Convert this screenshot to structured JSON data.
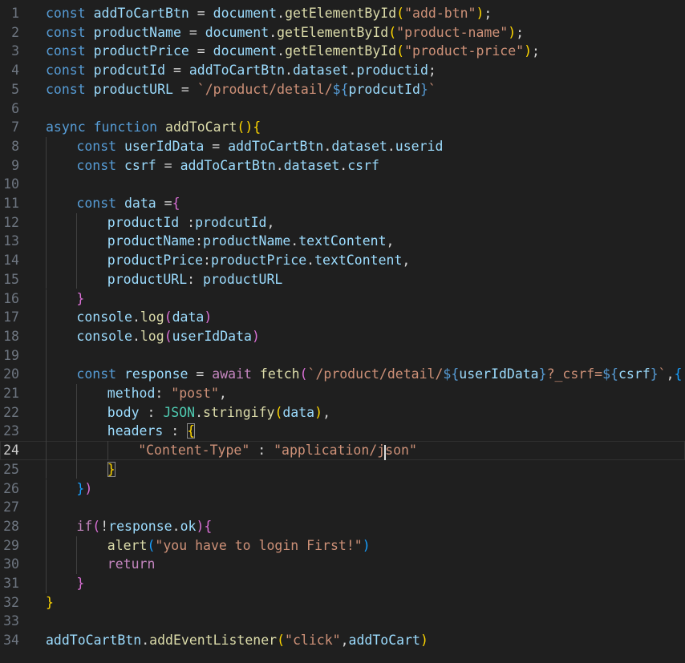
{
  "editor": {
    "current_line": 24,
    "colors": {
      "background": "#1f1f1f",
      "keyword": "#569cd6",
      "control": "#c586c0",
      "variable": "#9cdcfe",
      "function": "#dcdcaa",
      "string": "#ce9178",
      "object": "#4ec9b0",
      "bracket1": "#ffd700",
      "bracket2": "#da70d6",
      "bracket3": "#179fff",
      "text": "#d4d4d4"
    },
    "lines": [
      {
        "n": "1",
        "ind": 0,
        "tokens": [
          [
            "const ",
            "kw"
          ],
          [
            "addToCartBtn",
            "cst"
          ],
          [
            " = ",
            "tx"
          ],
          [
            "document",
            "var"
          ],
          [
            ".",
            "tx"
          ],
          [
            "getElementById",
            "fn"
          ],
          [
            "(",
            "b1"
          ],
          [
            "\"add-btn\"",
            "str"
          ],
          [
            ")",
            "b1"
          ],
          [
            ";",
            "tx"
          ]
        ]
      },
      {
        "n": "2",
        "ind": 0,
        "tokens": [
          [
            "const ",
            "kw"
          ],
          [
            "productName",
            "cst"
          ],
          [
            " = ",
            "tx"
          ],
          [
            "document",
            "var"
          ],
          [
            ".",
            "tx"
          ],
          [
            "getElementById",
            "fn"
          ],
          [
            "(",
            "b1"
          ],
          [
            "\"product-name\"",
            "str"
          ],
          [
            ")",
            "b1"
          ],
          [
            ";",
            "tx"
          ]
        ]
      },
      {
        "n": "3",
        "ind": 0,
        "tokens": [
          [
            "const ",
            "kw"
          ],
          [
            "productPrice",
            "cst"
          ],
          [
            " = ",
            "tx"
          ],
          [
            "document",
            "var"
          ],
          [
            ".",
            "tx"
          ],
          [
            "getElementById",
            "fn"
          ],
          [
            "(",
            "b1"
          ],
          [
            "\"product-price\"",
            "str"
          ],
          [
            ")",
            "b1"
          ],
          [
            ";",
            "tx"
          ]
        ]
      },
      {
        "n": "4",
        "ind": 0,
        "tokens": [
          [
            "const ",
            "kw"
          ],
          [
            "prodcutId",
            "cst"
          ],
          [
            " = ",
            "tx"
          ],
          [
            "addToCartBtn",
            "cst"
          ],
          [
            ".",
            "tx"
          ],
          [
            "dataset",
            "var"
          ],
          [
            ".",
            "tx"
          ],
          [
            "productid",
            "var"
          ],
          [
            ";",
            "tx"
          ]
        ]
      },
      {
        "n": "5",
        "ind": 0,
        "tokens": [
          [
            "const ",
            "kw"
          ],
          [
            "productURL",
            "cst"
          ],
          [
            " = ",
            "tx"
          ],
          [
            "`/product/detail/",
            "str"
          ],
          [
            "${",
            "kw"
          ],
          [
            "prodcutId",
            "cst"
          ],
          [
            "}",
            "kw"
          ],
          [
            "`",
            "str"
          ]
        ]
      },
      {
        "n": "6",
        "ind": 0,
        "tokens": []
      },
      {
        "n": "7",
        "ind": 0,
        "tokens": [
          [
            "async ",
            "kw"
          ],
          [
            "function ",
            "kw"
          ],
          [
            "addToCart",
            "fn"
          ],
          [
            "()",
            "b1"
          ],
          [
            "{",
            "b1"
          ]
        ]
      },
      {
        "n": "8",
        "ind": 1,
        "tokens": [
          [
            "const ",
            "kw"
          ],
          [
            "userIdData",
            "cst"
          ],
          [
            " = ",
            "tx"
          ],
          [
            "addToCartBtn",
            "cst"
          ],
          [
            ".",
            "tx"
          ],
          [
            "dataset",
            "var"
          ],
          [
            ".",
            "tx"
          ],
          [
            "userid",
            "var"
          ]
        ]
      },
      {
        "n": "9",
        "ind": 1,
        "tokens": [
          [
            "const ",
            "kw"
          ],
          [
            "csrf",
            "cst"
          ],
          [
            " = ",
            "tx"
          ],
          [
            "addToCartBtn",
            "cst"
          ],
          [
            ".",
            "tx"
          ],
          [
            "dataset",
            "var"
          ],
          [
            ".",
            "tx"
          ],
          [
            "csrf",
            "var"
          ]
        ]
      },
      {
        "n": "10",
        "ind": 1,
        "tokens": []
      },
      {
        "n": "11",
        "ind": 1,
        "tokens": [
          [
            "const ",
            "kw"
          ],
          [
            "data",
            "cst"
          ],
          [
            " =",
            "tx"
          ],
          [
            "{",
            "b2"
          ]
        ]
      },
      {
        "n": "12",
        "ind": 2,
        "tokens": [
          [
            "productId ",
            "var"
          ],
          [
            ":",
            "tx"
          ],
          [
            "prodcutId",
            "cst"
          ],
          [
            ",",
            "tx"
          ]
        ]
      },
      {
        "n": "13",
        "ind": 2,
        "tokens": [
          [
            "productName",
            "var"
          ],
          [
            ":",
            "tx"
          ],
          [
            "productName",
            "cst"
          ],
          [
            ".",
            "tx"
          ],
          [
            "textContent",
            "var"
          ],
          [
            ",",
            "tx"
          ]
        ]
      },
      {
        "n": "14",
        "ind": 2,
        "tokens": [
          [
            "productPrice",
            "var"
          ],
          [
            ":",
            "tx"
          ],
          [
            "productPrice",
            "cst"
          ],
          [
            ".",
            "tx"
          ],
          [
            "textContent",
            "var"
          ],
          [
            ",",
            "tx"
          ]
        ]
      },
      {
        "n": "15",
        "ind": 2,
        "tokens": [
          [
            "productURL",
            "var"
          ],
          [
            ": ",
            "tx"
          ],
          [
            "productURL",
            "cst"
          ]
        ]
      },
      {
        "n": "16",
        "ind": 1,
        "tokens": [
          [
            "}",
            "b2"
          ]
        ]
      },
      {
        "n": "17",
        "ind": 1,
        "tokens": [
          [
            "console",
            "var"
          ],
          [
            ".",
            "tx"
          ],
          [
            "log",
            "fn"
          ],
          [
            "(",
            "b2"
          ],
          [
            "data",
            "cst"
          ],
          [
            ")",
            "b2"
          ]
        ]
      },
      {
        "n": "18",
        "ind": 1,
        "tokens": [
          [
            "console",
            "var"
          ],
          [
            ".",
            "tx"
          ],
          [
            "log",
            "fn"
          ],
          [
            "(",
            "b2"
          ],
          [
            "userIdData",
            "cst"
          ],
          [
            ")",
            "b2"
          ]
        ]
      },
      {
        "n": "19",
        "ind": 1,
        "tokens": []
      },
      {
        "n": "20",
        "ind": 1,
        "tokens": [
          [
            "const ",
            "kw"
          ],
          [
            "response",
            "cst"
          ],
          [
            " = ",
            "tx"
          ],
          [
            "await ",
            "ctl"
          ],
          [
            "fetch",
            "fn"
          ],
          [
            "(",
            "b2"
          ],
          [
            "`/product/detail/",
            "str"
          ],
          [
            "${",
            "kw"
          ],
          [
            "userIdData",
            "cst"
          ],
          [
            "}",
            "kw"
          ],
          [
            "?_csrf=",
            "str"
          ],
          [
            "${",
            "kw"
          ],
          [
            "csrf",
            "cst"
          ],
          [
            "}",
            "kw"
          ],
          [
            "`",
            "str"
          ],
          [
            ",",
            "tx"
          ],
          [
            "{",
            "b3"
          ]
        ]
      },
      {
        "n": "21",
        "ind": 2,
        "tokens": [
          [
            "method",
            "var"
          ],
          [
            ": ",
            "tx"
          ],
          [
            "\"post\"",
            "str"
          ],
          [
            ",",
            "tx"
          ]
        ]
      },
      {
        "n": "22",
        "ind": 2,
        "tokens": [
          [
            "body ",
            "var"
          ],
          [
            ": ",
            "tx"
          ],
          [
            "JSON",
            "obj"
          ],
          [
            ".",
            "tx"
          ],
          [
            "stringify",
            "fn"
          ],
          [
            "(",
            "b1"
          ],
          [
            "data",
            "cst"
          ],
          [
            ")",
            "b1"
          ],
          [
            ",",
            "tx"
          ]
        ]
      },
      {
        "n": "23",
        "ind": 2,
        "tokens": [
          [
            "headers ",
            "var"
          ],
          [
            ": ",
            "tx"
          ],
          [
            "{",
            "b1m"
          ]
        ]
      },
      {
        "n": "24",
        "ind": 3,
        "tokens": [
          [
            "\"Content-Type\"",
            "str"
          ],
          [
            " : ",
            "tx"
          ],
          [
            "\"application/j",
            "str"
          ],
          [
            "son\"",
            "str"
          ]
        ]
      },
      {
        "n": "25",
        "ind": 2,
        "tokens": [
          [
            "}",
            "b1m"
          ]
        ]
      },
      {
        "n": "26",
        "ind": 1,
        "tokens": [
          [
            "}",
            "b3"
          ],
          [
            ")",
            "b2"
          ]
        ]
      },
      {
        "n": "27",
        "ind": 1,
        "tokens": []
      },
      {
        "n": "28",
        "ind": 1,
        "tokens": [
          [
            "if",
            "ctl"
          ],
          [
            "(",
            "b2"
          ],
          [
            "!",
            "tx"
          ],
          [
            "response",
            "cst"
          ],
          [
            ".",
            "tx"
          ],
          [
            "ok",
            "var"
          ],
          [
            ")",
            "b2"
          ],
          [
            "{",
            "b2"
          ]
        ]
      },
      {
        "n": "29",
        "ind": 2,
        "tokens": [
          [
            "alert",
            "fn"
          ],
          [
            "(",
            "b3"
          ],
          [
            "\"you have to login First!\"",
            "str"
          ],
          [
            ")",
            "b3"
          ]
        ]
      },
      {
        "n": "30",
        "ind": 2,
        "tokens": [
          [
            "return",
            "ctl"
          ]
        ]
      },
      {
        "n": "31",
        "ind": 1,
        "tokens": [
          [
            "}",
            "b2"
          ]
        ]
      },
      {
        "n": "32",
        "ind": 0,
        "tokens": [
          [
            "}",
            "b1"
          ]
        ]
      },
      {
        "n": "33",
        "ind": 0,
        "tokens": []
      },
      {
        "n": "34",
        "ind": 0,
        "tokens": [
          [
            "addToCartBtn",
            "cst"
          ],
          [
            ".",
            "tx"
          ],
          [
            "addEventListener",
            "fn"
          ],
          [
            "(",
            "b1"
          ],
          [
            "\"click\"",
            "str"
          ],
          [
            ",",
            "tx"
          ],
          [
            "addToCart",
            "cst"
          ],
          [
            ")",
            "b1"
          ]
        ]
      }
    ]
  }
}
